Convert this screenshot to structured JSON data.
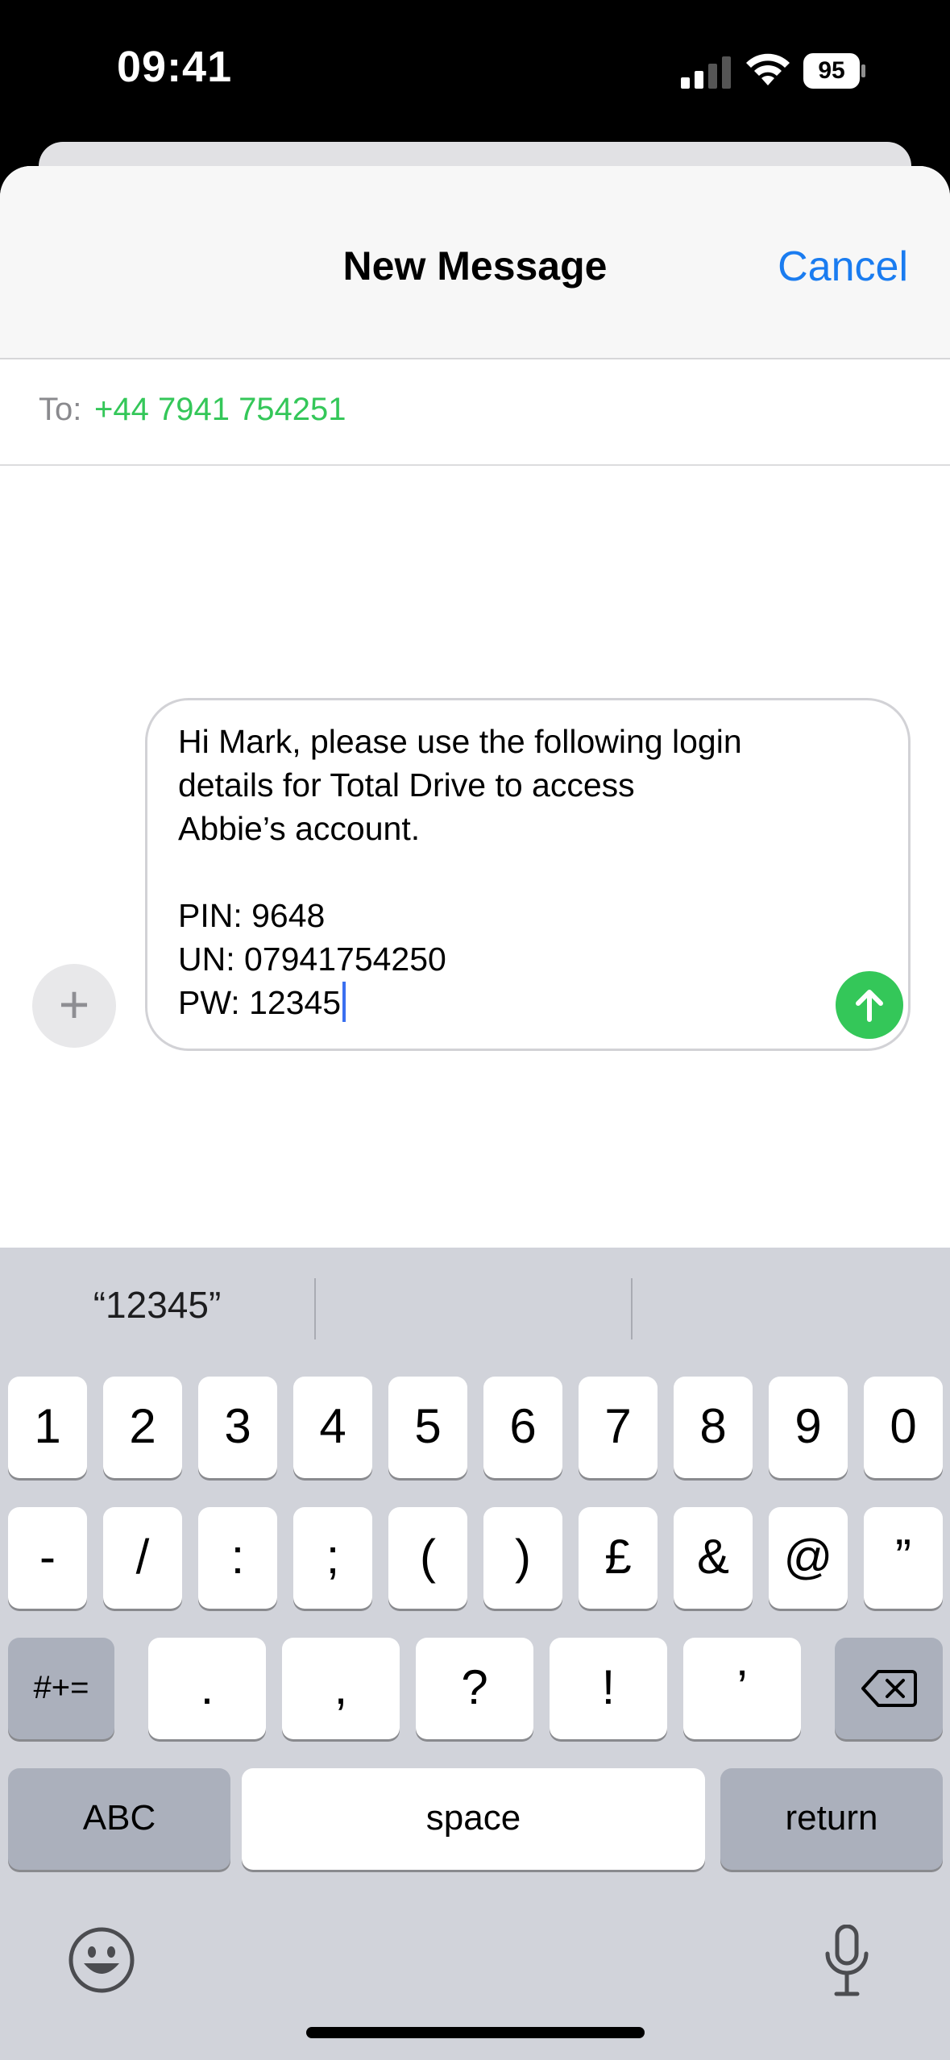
{
  "status_bar": {
    "time": "09:41",
    "battery": "95"
  },
  "nav": {
    "title": "New Message",
    "cancel_label": "Cancel"
  },
  "recipient": {
    "label": "To:",
    "number": "+44 7941 754251"
  },
  "compose": {
    "text": "Hi Mark, please use the following login\ndetails for Total Drive to access\nAbbie’s account.\n\nPIN: 9648\nUN: 07941754250\nPW: 12345"
  },
  "keyboard": {
    "prediction": "“12345”",
    "row1": [
      "1",
      "2",
      "3",
      "4",
      "5",
      "6",
      "7",
      "8",
      "9",
      "0"
    ],
    "row2": [
      "-",
      "/",
      ":",
      ";",
      "(",
      ")",
      "£",
      "&",
      "@",
      "”"
    ],
    "row3": {
      "toggle": "#+=",
      "keys": [
        ".",
        ",",
        "?",
        "!",
        "’"
      ]
    },
    "row4": {
      "abc": "ABC",
      "space": "space",
      "return": "return"
    }
  },
  "colors": {
    "accent_blue": "#1a7cf0",
    "green": "#34c759",
    "keyboard_bg": "#d1d3da"
  },
  "icons": [
    "signal-icon",
    "wifi-icon",
    "battery-icon",
    "plus-icon",
    "send-arrow-icon",
    "delete-icon",
    "emoji-icon",
    "microphone-icon"
  ]
}
